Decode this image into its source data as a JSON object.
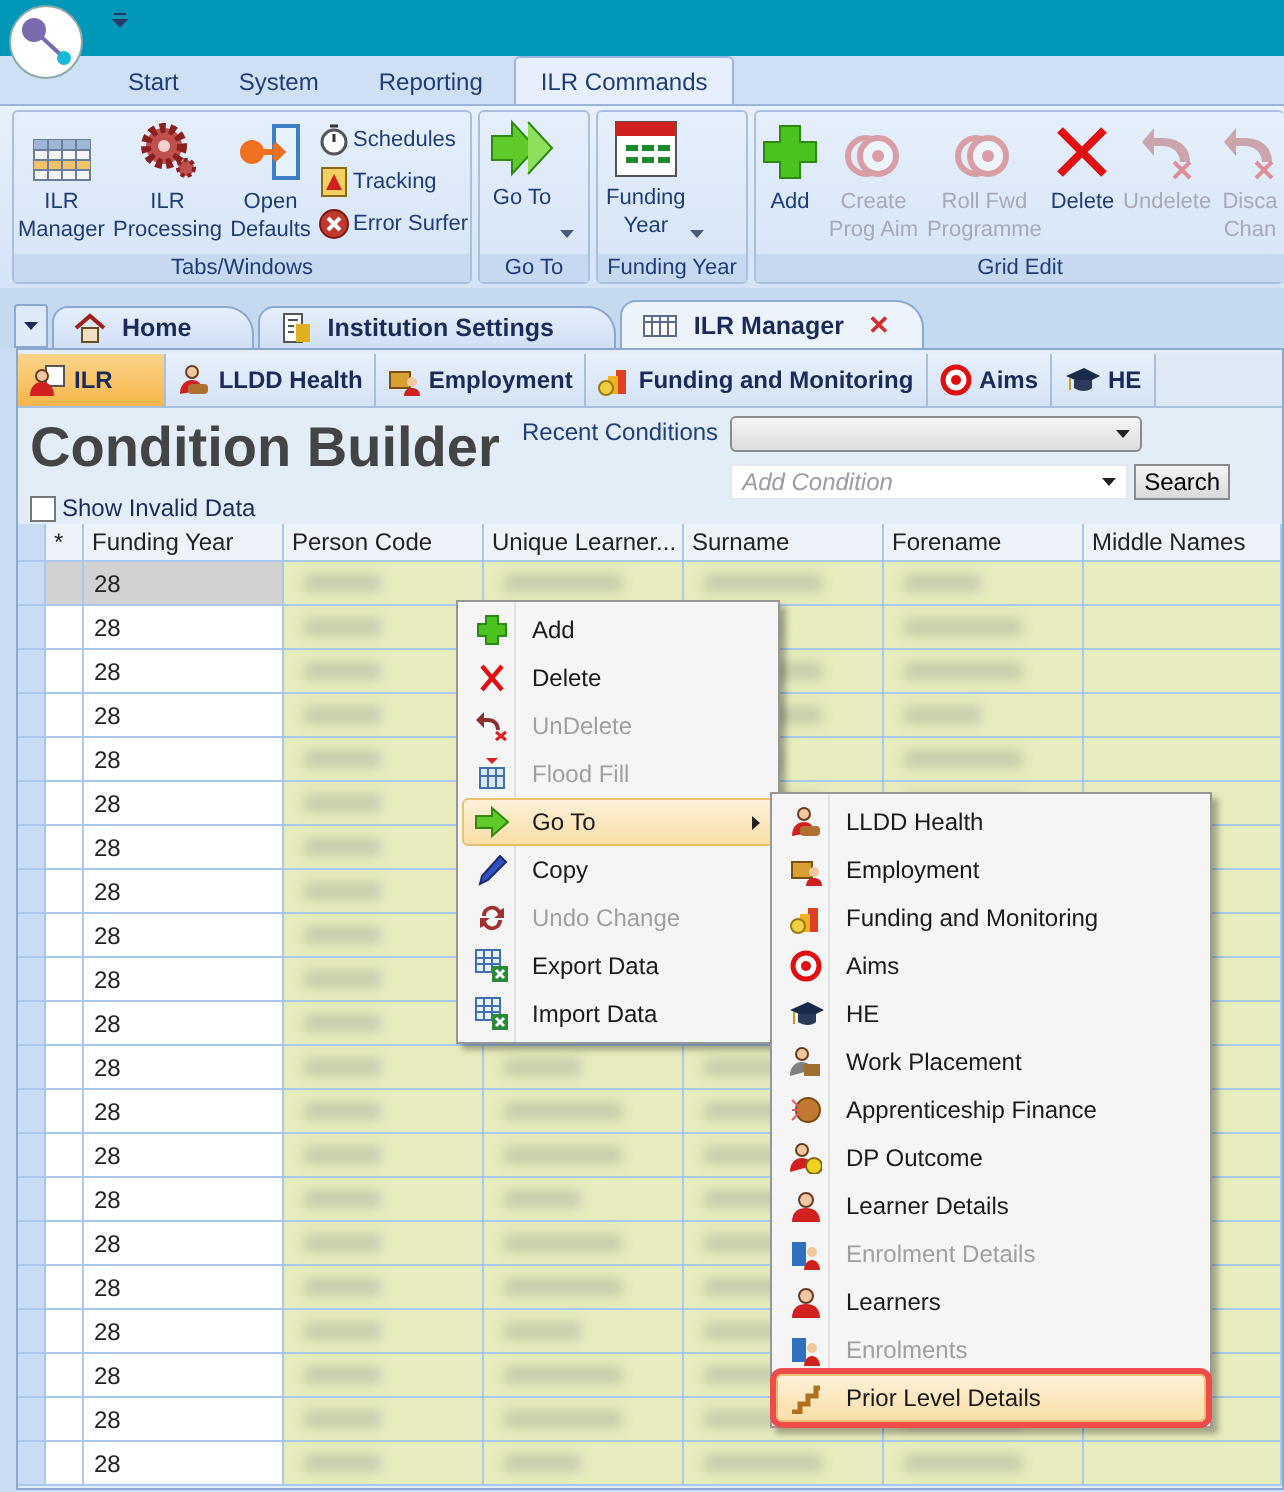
{
  "ribbon_tabs": [
    {
      "label": "Start",
      "selected": false
    },
    {
      "label": "System",
      "selected": false
    },
    {
      "label": "Reporting",
      "selected": false
    },
    {
      "label": "ILR Commands",
      "selected": true
    }
  ],
  "ribbon_groups": [
    {
      "label": "Tabs/Windows",
      "buttons": [
        {
          "kind": "large",
          "label": "ILR\nManager",
          "disabled": false
        },
        {
          "kind": "large",
          "label": "ILR\nProcessing",
          "disabled": false
        },
        {
          "kind": "large",
          "label": "Open\nDefaults",
          "disabled": false
        },
        {
          "kind": "small",
          "label": "Schedules",
          "disabled": false
        },
        {
          "kind": "small",
          "label": "Tracking",
          "disabled": false
        },
        {
          "kind": "small",
          "label": "Error Surfer",
          "disabled": false
        }
      ]
    },
    {
      "label": "Go To",
      "buttons": [
        {
          "kind": "split",
          "label": "Go To",
          "disabled": false
        }
      ]
    },
    {
      "label": "Funding Year",
      "buttons": [
        {
          "kind": "split",
          "label": "Funding\nYear",
          "disabled": false
        }
      ]
    },
    {
      "label": "Grid Edit",
      "buttons": [
        {
          "kind": "large",
          "label": "Add",
          "disabled": false
        },
        {
          "kind": "large",
          "label": "Create\nProg Aim",
          "disabled": true
        },
        {
          "kind": "large",
          "label": "Roll Fwd\nProgramme",
          "disabled": true
        },
        {
          "kind": "large",
          "label": "Delete",
          "disabled": false
        },
        {
          "kind": "large",
          "label": "Undelete",
          "disabled": true
        },
        {
          "kind": "large",
          "label": "Disca\nChan",
          "disabled": true
        }
      ]
    }
  ],
  "doc_tabs": [
    {
      "label": "Home",
      "selected": false,
      "closable": false
    },
    {
      "label": "Institution Settings",
      "selected": false,
      "closable": false
    },
    {
      "label": "ILR Manager",
      "selected": true,
      "closable": true
    }
  ],
  "close_glyph": "✕",
  "sub_tabs": [
    {
      "label": "ILR",
      "selected": true
    },
    {
      "label": "LLDD Health",
      "selected": false
    },
    {
      "label": "Employment",
      "selected": false
    },
    {
      "label": "Funding and Monitoring",
      "selected": false
    },
    {
      "label": "Aims",
      "selected": false
    },
    {
      "label": "HE",
      "selected": false
    }
  ],
  "condition_builder": {
    "title": "Condition Builder",
    "recent_label": "Recent Conditions",
    "add_placeholder": "Add Condition",
    "search_button": "Search",
    "show_invalid": {
      "label": "Show Invalid Data",
      "checked": false
    }
  },
  "grid": {
    "columns": [
      "*",
      "Funding Year",
      "Person Code",
      "Unique Learner...",
      "Surname",
      "Forename",
      "Middle Names"
    ],
    "rows": [
      {
        "funding_year": "28",
        "selected": true
      },
      {
        "funding_year": "28",
        "selected": false
      },
      {
        "funding_year": "28",
        "selected": false
      },
      {
        "funding_year": "28",
        "selected": false
      },
      {
        "funding_year": "28",
        "selected": false
      },
      {
        "funding_year": "28",
        "selected": false
      },
      {
        "funding_year": "28",
        "selected": false
      },
      {
        "funding_year": "28",
        "selected": false
      },
      {
        "funding_year": "28",
        "selected": false
      },
      {
        "funding_year": "28",
        "selected": false
      },
      {
        "funding_year": "28",
        "selected": false
      },
      {
        "funding_year": "28",
        "selected": false
      },
      {
        "funding_year": "28",
        "selected": false
      },
      {
        "funding_year": "28",
        "selected": false
      },
      {
        "funding_year": "28",
        "selected": false
      },
      {
        "funding_year": "28",
        "selected": false
      },
      {
        "funding_year": "28",
        "selected": false
      },
      {
        "funding_year": "28",
        "selected": false
      },
      {
        "funding_year": "28",
        "selected": false
      },
      {
        "funding_year": "28",
        "selected": false
      },
      {
        "funding_year": "28",
        "selected": false
      }
    ]
  },
  "context_menu": [
    {
      "label": "Add",
      "disabled": false,
      "selected": false,
      "submenu": false
    },
    {
      "label": "Delete",
      "disabled": false,
      "selected": false,
      "submenu": false
    },
    {
      "label": "UnDelete",
      "disabled": true,
      "selected": false,
      "submenu": false
    },
    {
      "label": "Flood Fill",
      "disabled": true,
      "selected": false,
      "submenu": false
    },
    {
      "label": "Go To",
      "disabled": false,
      "selected": true,
      "submenu": true
    },
    {
      "label": "Copy",
      "disabled": false,
      "selected": false,
      "submenu": false
    },
    {
      "label": "Undo Change",
      "disabled": true,
      "selected": false,
      "submenu": false
    },
    {
      "label": "Export Data",
      "disabled": false,
      "selected": false,
      "submenu": false
    },
    {
      "label": "Import Data",
      "disabled": false,
      "selected": false,
      "submenu": false
    }
  ],
  "go_to_submenu": [
    {
      "label": "LLDD Health",
      "disabled": false,
      "selected": false,
      "outlined": false
    },
    {
      "label": "Employment",
      "disabled": false,
      "selected": false,
      "outlined": false
    },
    {
      "label": "Funding and Monitoring",
      "disabled": false,
      "selected": false,
      "outlined": false
    },
    {
      "label": "Aims",
      "disabled": false,
      "selected": false,
      "outlined": false
    },
    {
      "label": "HE",
      "disabled": false,
      "selected": false,
      "outlined": false
    },
    {
      "label": "Work Placement",
      "disabled": false,
      "selected": false,
      "outlined": false
    },
    {
      "label": "Apprenticeship Finance",
      "disabled": false,
      "selected": false,
      "outlined": false
    },
    {
      "label": "DP Outcome",
      "disabled": false,
      "selected": false,
      "outlined": false
    },
    {
      "label": "Learner Details",
      "disabled": false,
      "selected": false,
      "outlined": false
    },
    {
      "label": "Enrolment Details",
      "disabled": true,
      "selected": false,
      "outlined": false
    },
    {
      "label": "Learners",
      "disabled": false,
      "selected": false,
      "outlined": false
    },
    {
      "label": "Enrolments",
      "disabled": true,
      "selected": false,
      "outlined": false
    },
    {
      "label": "Prior Level Details",
      "disabled": false,
      "selected": true,
      "outlined": true
    }
  ]
}
